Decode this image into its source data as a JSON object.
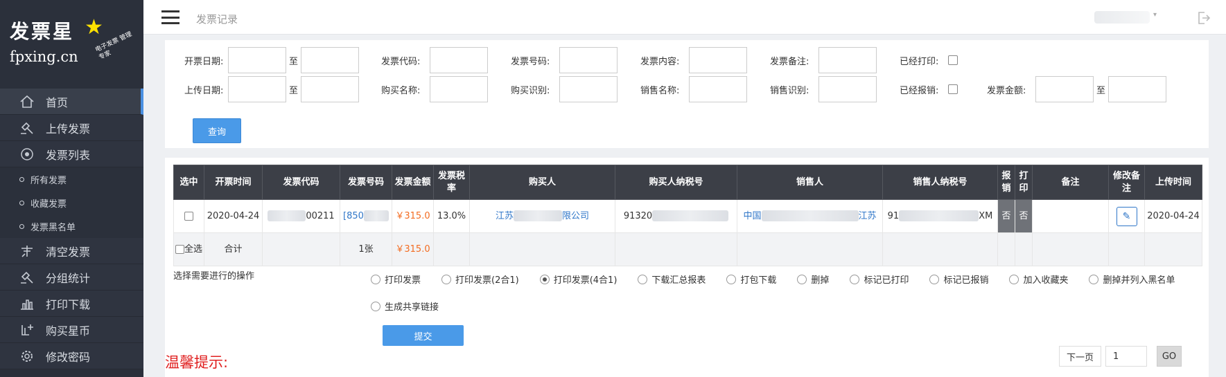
{
  "logo": {
    "brand": "发票星",
    "domain": "fpxing.cn",
    "slogan": "电子发票 管理专家"
  },
  "header": {
    "title": "发票记录"
  },
  "sidebar": {
    "items": [
      {
        "label": "首页",
        "icon": "home-icon"
      },
      {
        "label": "上传发票",
        "icon": "gavel-icon"
      },
      {
        "label": "发票列表",
        "icon": "target-icon"
      },
      {
        "label": "所有发票",
        "icon": "dot-icon"
      },
      {
        "label": "收藏发票",
        "icon": "dot-icon"
      },
      {
        "label": "发票黑名单",
        "icon": "dot-icon"
      },
      {
        "label": "清空发票",
        "icon": "clear-icon"
      },
      {
        "label": "分组统计",
        "icon": "gavel-icon"
      },
      {
        "label": "打印下载",
        "icon": "bar-chart-icon"
      },
      {
        "label": "购买星币",
        "icon": "cart-plus-icon"
      },
      {
        "label": "修改密码",
        "icon": "gear-icon"
      }
    ]
  },
  "filter": {
    "invoice_date": "开票日期:",
    "to": "至",
    "invoice_code": "发票代码:",
    "invoice_number": "发票号码:",
    "invoice_content": "发票内容:",
    "invoice_remark": "发票备注:",
    "printed": "已经打印:",
    "upload_date": "上传日期:",
    "buyer_name": "购买名称:",
    "buyer_id": "购买识别:",
    "seller_name": "销售名称:",
    "seller_id": "销售识别:",
    "reimbursed": "已经报销:",
    "amount": "发票金额:",
    "query_button": "查询"
  },
  "table": {
    "headers": [
      "选中",
      "开票时间",
      "发票代码",
      "发票号码",
      "发票金额",
      "发票税率",
      "购买人",
      "购买人纳税号",
      "销售人",
      "销售人纳税号",
      "报销",
      "打印",
      "备注",
      "修改备注",
      "上传时间"
    ],
    "row": {
      "date": "2020-04-24",
      "code": "00211",
      "number": "[850",
      "amount": "￥315.0",
      "tax_rate": "13.0%",
      "buyer_a": "江苏",
      "buyer_b": "限公司",
      "buyer_tax": "91320",
      "seller": "中国",
      "seller_b": "江苏",
      "seller_tax_a": "91",
      "seller_tax_b": "XM",
      "reimbursed": "否",
      "printed": "否",
      "upload_date": "2020-04-24"
    },
    "total": {
      "select_all": "全选",
      "label": "合计",
      "count": "1张",
      "amount": "￥315.0"
    }
  },
  "ops": {
    "label": "选择需要进行的操作",
    "options": [
      "打印发票",
      "打印发票(2合1)",
      "打印发票(4合1)",
      "下载汇总报表",
      "打包下载",
      "删掉",
      "标记已打印",
      "标记已报销",
      "加入收藏夹",
      "删掉并列入黑名单"
    ],
    "selected": 2,
    "share_link": "生成共享链接",
    "submit": "提交"
  },
  "tip": "温馨提示:",
  "pager": {
    "next": "下一页",
    "page": "1",
    "go": "GO"
  }
}
